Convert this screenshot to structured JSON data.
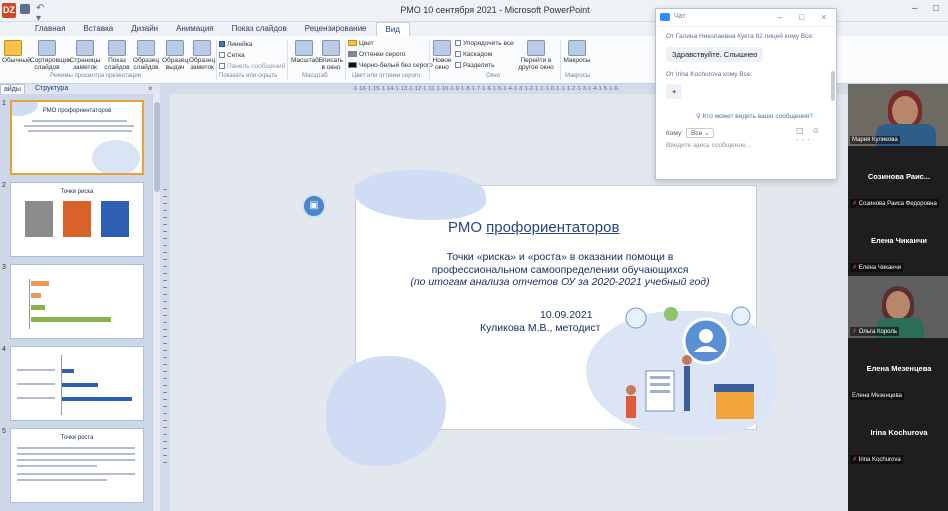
{
  "window": {
    "title": "РМО 10 сентября 2021 - Microsoft PowerPoint",
    "app_logo": "Ǳ",
    "qat_undo": "↶ ▾",
    "controls": [
      "–",
      "□"
    ]
  },
  "ribbon_tabs": [
    "Главная",
    "Вставка",
    "Дизайн",
    "Анимация",
    "Показ слайдов",
    "Рецензирование",
    "Вид"
  ],
  "active_tab": "Вид",
  "ribbon": {
    "buttons": {
      "normal": "Обычный",
      "sorter": "Сортировщик слайдов",
      "notes": "Страницы заметок",
      "reading": "Показ слайдов",
      "slide_master": "Образец слайдов",
      "handout_master": "Образец выдач",
      "notes_master": "Образец заметок",
      "zoom": "Масштаб",
      "fit": "Вписать в окно",
      "new_window": "Новое окно",
      "switch_windows": "Перейти в другое окно",
      "macros": "Макросы"
    },
    "checks": {
      "ruler": "Линейка",
      "grid": "Сетка",
      "message_bar": "Панель сообщений"
    },
    "color_modes": {
      "color": "Цвет",
      "grayscale": "Оттенки серого",
      "bw": "Черно-белый без серого"
    },
    "window_cmds": {
      "arrange": "Упорядочить все",
      "cascade": "Каскадом",
      "split": "Разделить"
    },
    "groups": {
      "views": "Режимы просмотра презентации",
      "show_hide": "Показать или скрыть",
      "zoom": "Масштаб",
      "color": "Цвет или оттенки серого",
      "window": "Окно",
      "macros": "Макросы"
    }
  },
  "panel_tabs": [
    "айды",
    "Структура"
  ],
  "panel_close": "×",
  "ruler_text": "·1·16·1·15·1·14·1·13·1·12·1·11·1·10·1·9·1·8·1·7·1·6·1·5·1·4·1·3·1·2·1·1·1·0·1·1·1·2·1·3·1·4·1·5·1·6·",
  "thumbnails": [
    {
      "num": "1",
      "title": "РМО профориентаторов"
    },
    {
      "num": "2",
      "title": "Точки риска"
    },
    {
      "num": "3",
      "title": ""
    },
    {
      "num": "4",
      "title": ""
    },
    {
      "num": "5",
      "title": "Точки роста"
    }
  ],
  "slide": {
    "title_prefix": "РМО ",
    "title_link": "профориентаторов",
    "line1": "Точки «риска» и «роста» в оказании помощи в",
    "line2": "профессиональном самоопределении обучающихся",
    "line3": "(по итогам анализа отчетов ОУ за 2020-2021 учебный год)",
    "date": "10.09.2021",
    "author": "Куликова М.В., методист"
  },
  "present_icon": "▣",
  "chat": {
    "title": "Чат",
    "controls": [
      "–",
      "□",
      "×"
    ],
    "msg1_from": "От Галина Николаевна Кукта 82 лицей кому Все:",
    "msg1_text": "Здравствуйте. Слышнео",
    "msg2_from": "От Irina Kochurova кому Все:",
    "msg2_text": "+",
    "who_can_see": "Кто может видеть ваши сообщения?",
    "to_label": "Кому:",
    "to_value": "Все ⌄",
    "tools": "▢ ☺ ···",
    "input_placeholder": "Введите здесь сообщение..."
  },
  "participants": [
    {
      "name": "",
      "label": "Мария Куликова",
      "video": true,
      "muted": false
    },
    {
      "name": "Созинова  Раис...",
      "label": "Созинова Раиса Федоровна",
      "video": false,
      "muted": true
    },
    {
      "name": "Елена Чиканчи",
      "label": "Елена Чиканчи",
      "video": false,
      "muted": true
    },
    {
      "name": "",
      "label": "Ольга Король",
      "video": true,
      "muted": true
    },
    {
      "name": "Елена Мезенцева",
      "label": "Елена Мезенцева",
      "video": false,
      "muted": false
    },
    {
      "name": "Irina Kochurova",
      "label": "Irina Kochurova",
      "video": false,
      "muted": true
    }
  ],
  "mute_glyph": "✗"
}
